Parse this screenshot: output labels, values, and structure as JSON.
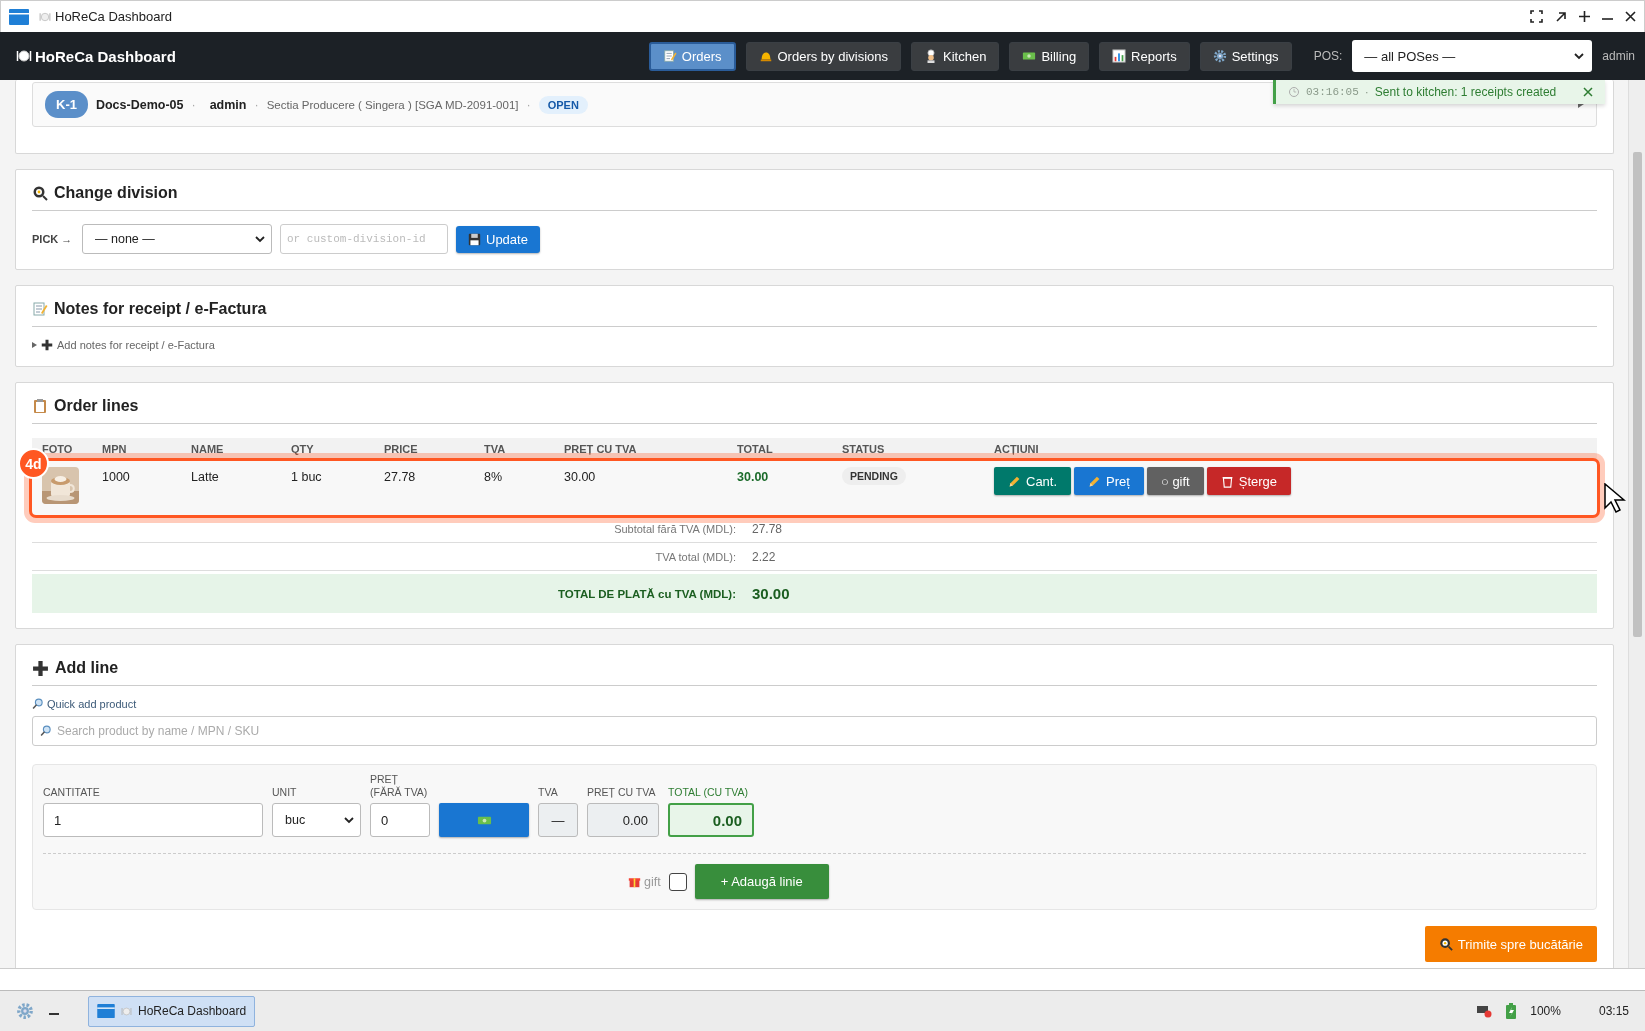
{
  "window": {
    "title": "HoReCa Dashboard"
  },
  "header": {
    "brand": "HoReCa Dashboard",
    "nav": [
      {
        "label": "Orders",
        "selected": true
      },
      {
        "label": "Orders by divisions",
        "selected": false
      },
      {
        "label": "Kitchen",
        "selected": false
      },
      {
        "label": "Billing",
        "selected": false
      },
      {
        "label": "Reports",
        "selected": false
      },
      {
        "label": "Settings",
        "selected": false
      }
    ],
    "pos_label": "POS:",
    "pos_value": "— all POSes —",
    "user": "admin"
  },
  "toast": {
    "time": "03:16:05",
    "separator": "·",
    "message": "Sent to kitchen: 1 receipts created"
  },
  "order": {
    "badge": "K-1",
    "parts": [
      {
        "kind": "name",
        "text": "Docs-Demo-05"
      },
      {
        "kind": "sep",
        "text": "·"
      },
      {
        "kind": "user",
        "text": "admin"
      },
      {
        "kind": "sep",
        "text": "·"
      },
      {
        "kind": "division",
        "text": "Sectia Producere ( Singera ) [SGA MD-2091-001]"
      },
      {
        "kind": "sep",
        "text": "·"
      }
    ],
    "status": "OPEN"
  },
  "change_division": {
    "title": "Change division",
    "pick_label": "PICK →",
    "select_value": "— none —",
    "custom_placeholder": "or custom-division-id",
    "button": "Update"
  },
  "notes": {
    "title": "Notes for receipt / e-Factura",
    "toggle": "Add notes for receipt / e-Factura",
    "expanded": false
  },
  "order_lines": {
    "title": "Order lines",
    "columns": [
      "FOTO",
      "MPN",
      "NAME",
      "QTY",
      "PRICE",
      "TVA",
      "PREȚ CU TVA",
      "TOTAL",
      "STATUS",
      "ACȚIUNI"
    ],
    "rows": [
      {
        "mpn": "1000",
        "name": "Latte",
        "qty": "1 buc",
        "price": "27.78",
        "tva": "8%",
        "pret_cu_tva": "30.00",
        "total": "30.00",
        "status": "PENDING",
        "highlighted": true,
        "actions": [
          {
            "kind": "qty",
            "label": "Cant."
          },
          {
            "kind": "price",
            "label": "Preț"
          },
          {
            "kind": "gift",
            "label": "○ gift"
          },
          {
            "kind": "delete",
            "label": "Șterge"
          }
        ]
      }
    ],
    "summary": [
      {
        "label": "Subtotal fără TVA (MDL):",
        "value": "27.78"
      },
      {
        "label": "TVA total (MDL):",
        "value": "2.22"
      }
    ],
    "grand_total": {
      "label": "TOTAL DE PLATĂ cu TVA (MDL):",
      "value": "30.00"
    }
  },
  "callout": {
    "label": "4d"
  },
  "add_line": {
    "title": "Add line",
    "quick_label": "Quick add product",
    "search_placeholder": "Search product by name / MPN / SKU",
    "qty_label": "CANTITATE",
    "qty_value": "1",
    "unit_label": "UNIT",
    "unit_value": "buc",
    "price_label": "PREȚ (FĂRĂ TVA)",
    "price_value": "0",
    "tva_label": "TVA",
    "tva_value": "—",
    "pret_cu_tva_label": "PREȚ CU TVA",
    "pret_cu_tva_value": "0.00",
    "total_label": "TOTAL (CU TVA)",
    "total_value": "0.00",
    "gift_label": "gift",
    "gift_checked": false,
    "add_button": "+ Adaugă linie"
  },
  "send_button": "Trimite spre bucătărie",
  "taskbar": {
    "app": "HoReCa Dashboard",
    "battery": "100%",
    "clock": "03:15"
  }
}
